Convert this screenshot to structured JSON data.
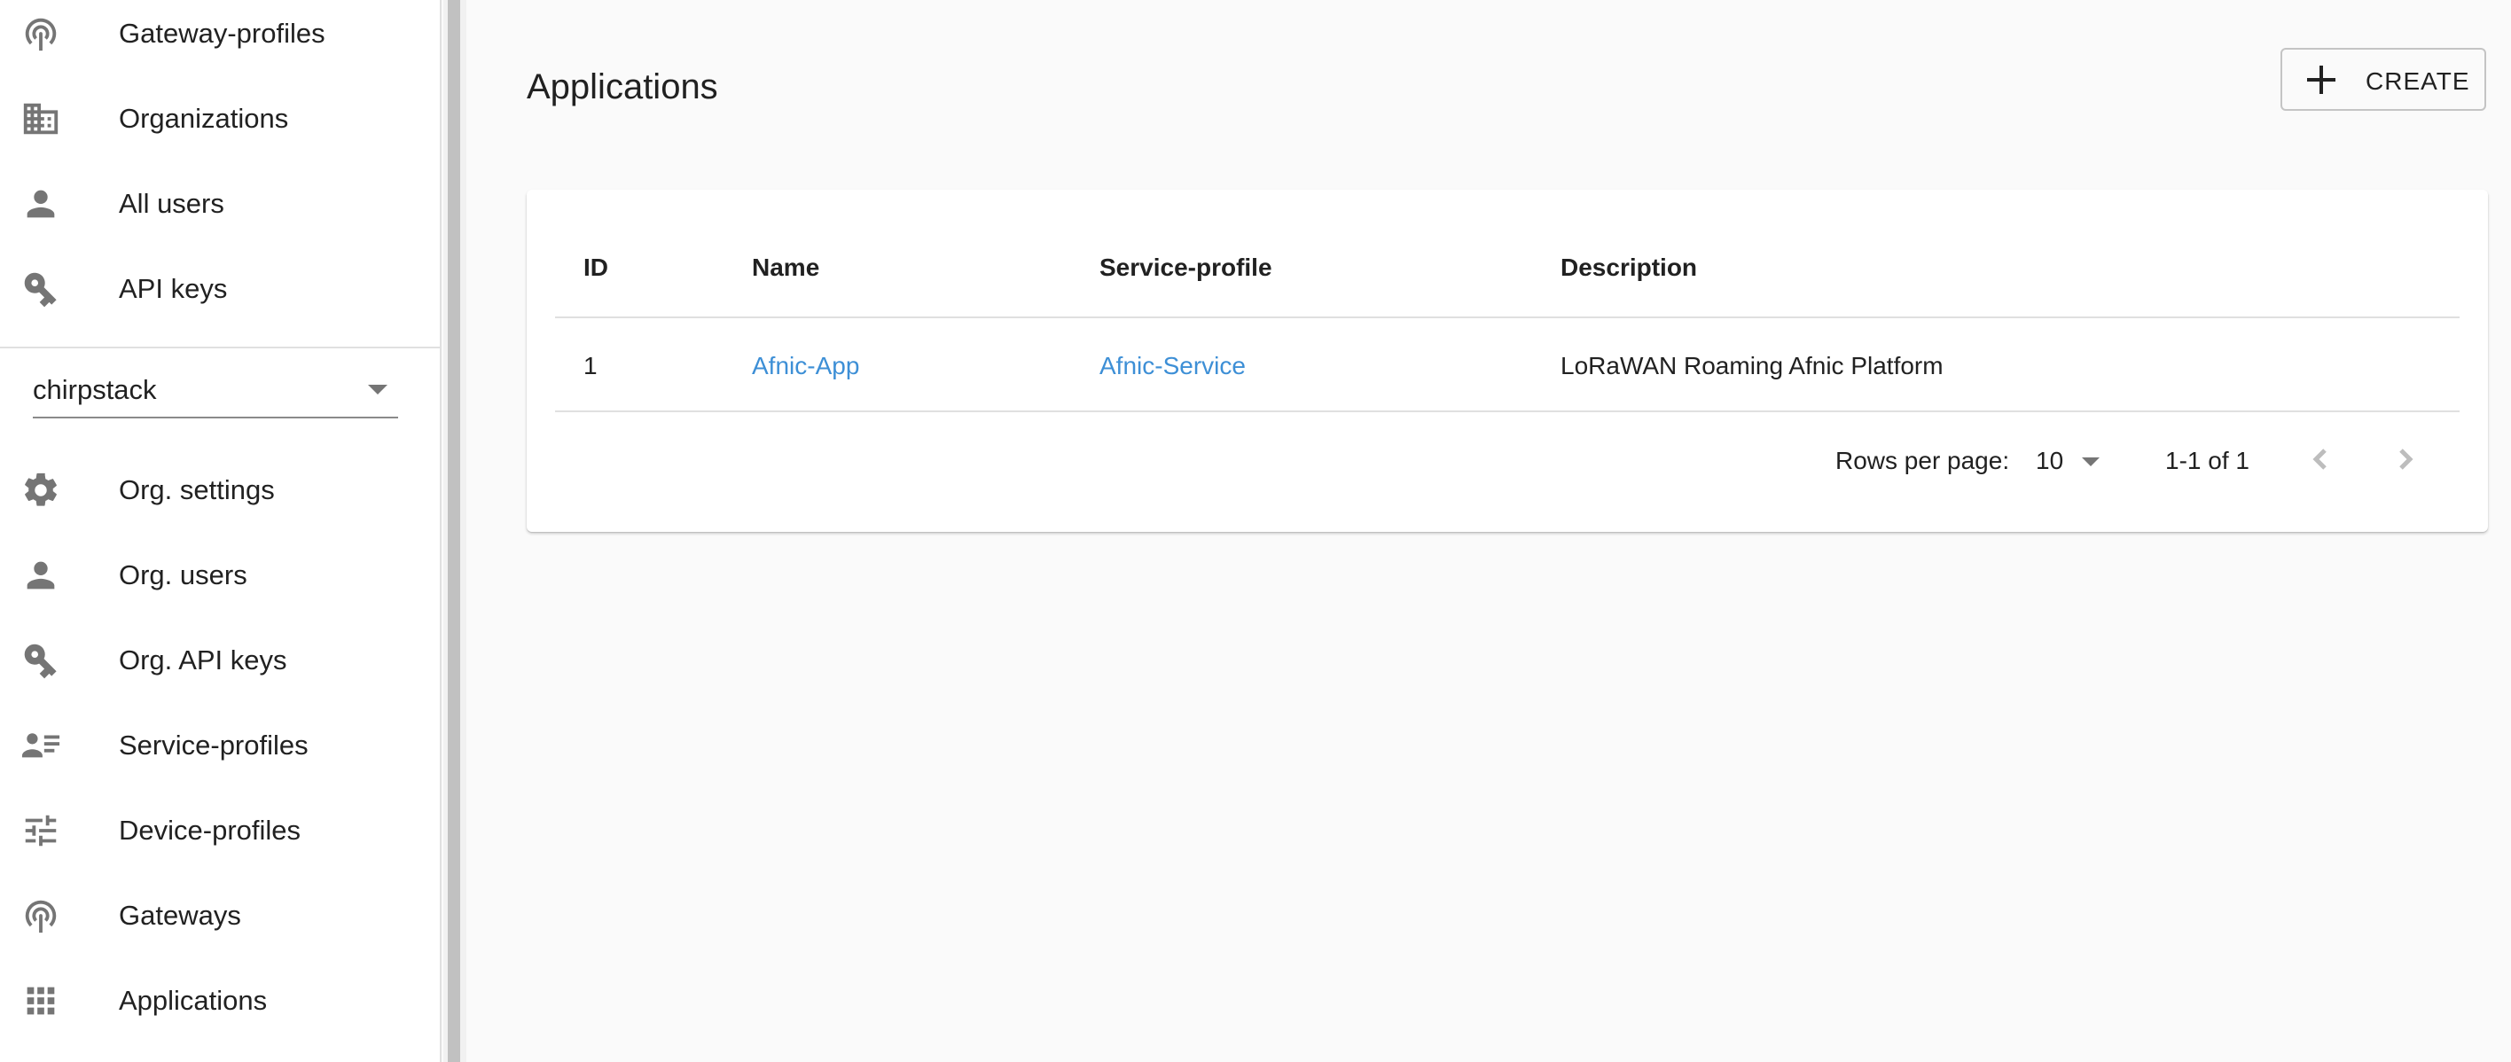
{
  "sidebar": {
    "top_items": [
      {
        "label": "Gateway-profiles",
        "icon": "gateway-icon"
      },
      {
        "label": "Organizations",
        "icon": "building-icon"
      },
      {
        "label": "All users",
        "icon": "person-icon"
      },
      {
        "label": "API keys",
        "icon": "key-icon"
      }
    ],
    "org_select": {
      "value": "chirpstack"
    },
    "org_items": [
      {
        "label": "Org. settings",
        "icon": "gear-icon"
      },
      {
        "label": "Org. users",
        "icon": "person-icon"
      },
      {
        "label": "Org. API keys",
        "icon": "key-icon"
      },
      {
        "label": "Service-profiles",
        "icon": "contact-list-icon"
      },
      {
        "label": "Device-profiles",
        "icon": "sliders-icon"
      },
      {
        "label": "Gateways",
        "icon": "gateway-icon"
      },
      {
        "label": "Applications",
        "icon": "apps-grid-icon"
      }
    ]
  },
  "main": {
    "title": "Applications",
    "create_label": "CREATE",
    "table": {
      "headers": [
        "ID",
        "Name",
        "Service-profile",
        "Description"
      ],
      "rows": [
        {
          "id": "1",
          "name": "Afnic-App",
          "service_profile": "Afnic-Service",
          "description": "LoRaWAN Roaming Afnic Platform"
        }
      ]
    },
    "pagination": {
      "rows_per_page_label": "Rows per page:",
      "rows_per_page": "10",
      "range": "1-1 of 1"
    }
  },
  "colors": {
    "link": "#3d8fd6",
    "icon": "#757575",
    "background": "#fafafa"
  }
}
